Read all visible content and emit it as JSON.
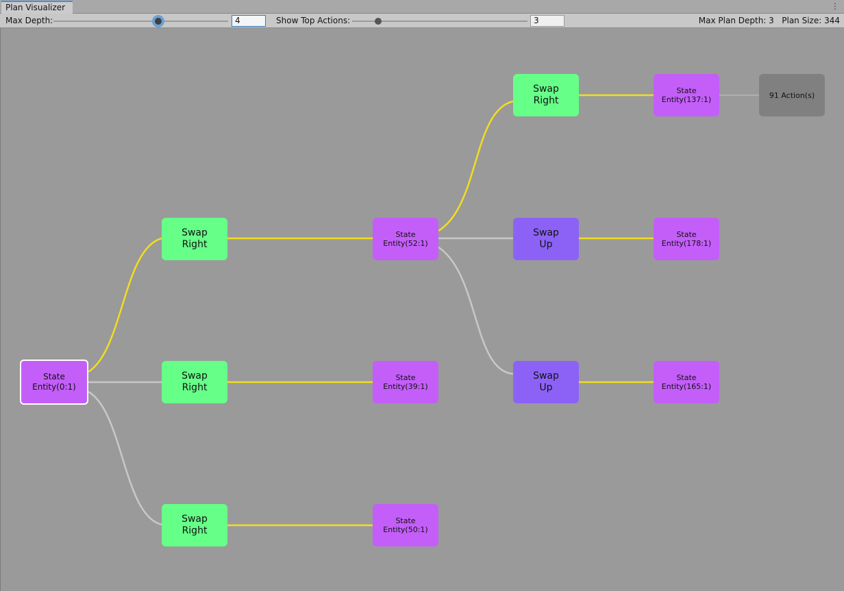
{
  "window": {
    "tab_title": "Plan Visualizer",
    "menu_icon": "kebab-menu-icon"
  },
  "toolbar": {
    "max_depth_label": "Max Depth:",
    "max_depth_value": "4",
    "max_depth_slider_fraction": 0.6,
    "top_actions_label": "Show Top Actions:",
    "top_actions_value": "3",
    "top_actions_slider_fraction": 0.15,
    "max_plan_depth_text": "Max Plan Depth: 3",
    "plan_size_text": "Plan Size: 344"
  },
  "colors": {
    "state": "#c45ef9",
    "action_swap_right": "#66ff88",
    "action_swap_up": "#8c62f6",
    "collapsed": "#808080",
    "selected_edge": "#f2dd1e",
    "other_edge": "#c8c8c8",
    "canvas": "#9a9a9a"
  },
  "graph": {
    "root": {
      "title": "State",
      "subtitle": "Entity(0:1)"
    },
    "level1_actions": [
      {
        "label_line1": "Swap",
        "label_line2": "Right"
      },
      {
        "label_line1": "Swap",
        "label_line2": "Right"
      },
      {
        "label_line1": "Swap",
        "label_line2": "Right"
      }
    ],
    "level1_states": [
      {
        "title": "State",
        "subtitle": "Entity(52:1)"
      },
      {
        "title": "State",
        "subtitle": "Entity(39:1)"
      },
      {
        "title": "State",
        "subtitle": "Entity(50:1)"
      }
    ],
    "level2_actions": [
      {
        "label_line1": "Swap",
        "label_line2": "Right"
      },
      {
        "label_line1": "Swap",
        "label_line2": "Up"
      },
      {
        "label_line1": "Swap",
        "label_line2": "Up"
      }
    ],
    "level2_states": [
      {
        "title": "State",
        "subtitle": "Entity(137:1)"
      },
      {
        "title": "State",
        "subtitle": "Entity(178:1)"
      },
      {
        "title": "State",
        "subtitle": "Entity(165:1)"
      }
    ],
    "collapsed": {
      "label": "91 Action(s)"
    }
  }
}
